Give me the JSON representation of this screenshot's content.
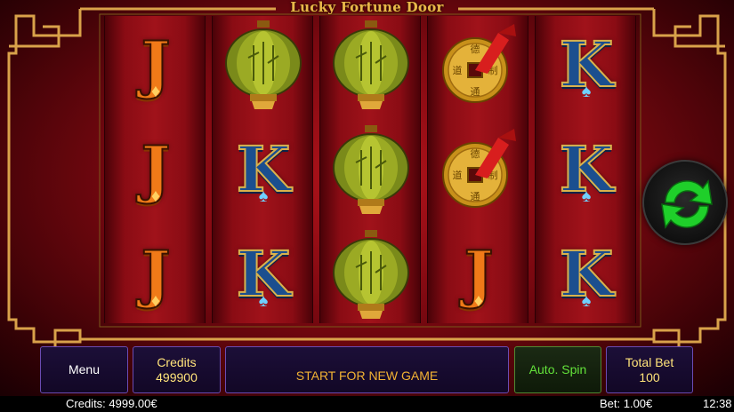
{
  "game": {
    "title": "Lucky Fortune Door"
  },
  "reels": [
    [
      "J",
      "J",
      "J"
    ],
    [
      "lantern",
      "K",
      "K"
    ],
    [
      "lantern",
      "lantern",
      "lantern"
    ],
    [
      "coin",
      "coin",
      "J"
    ],
    [
      "K",
      "K",
      "K"
    ]
  ],
  "colors": {
    "background_red": "#a0121a",
    "frame_gold": "#d9a24a",
    "panel_purple": "#1c0f38",
    "accent_gold_text": "#ffe37a",
    "auto_spin_green": "#63e23a",
    "spin_arrow_green": "#1fcf2a"
  },
  "controls": {
    "menu_label": "Menu",
    "credits_label": "Credits",
    "credits_value": "499900",
    "message": "START FOR NEW GAME",
    "autospin_label": "Auto. Spin",
    "totalbet_label": "Total Bet",
    "totalbet_value": "100",
    "spin_icon": "refresh-arrows-icon"
  },
  "status_bar": {
    "credits": "Credits: 4999.00€",
    "bet": "Bet: 1.00€",
    "time": "12:38"
  }
}
